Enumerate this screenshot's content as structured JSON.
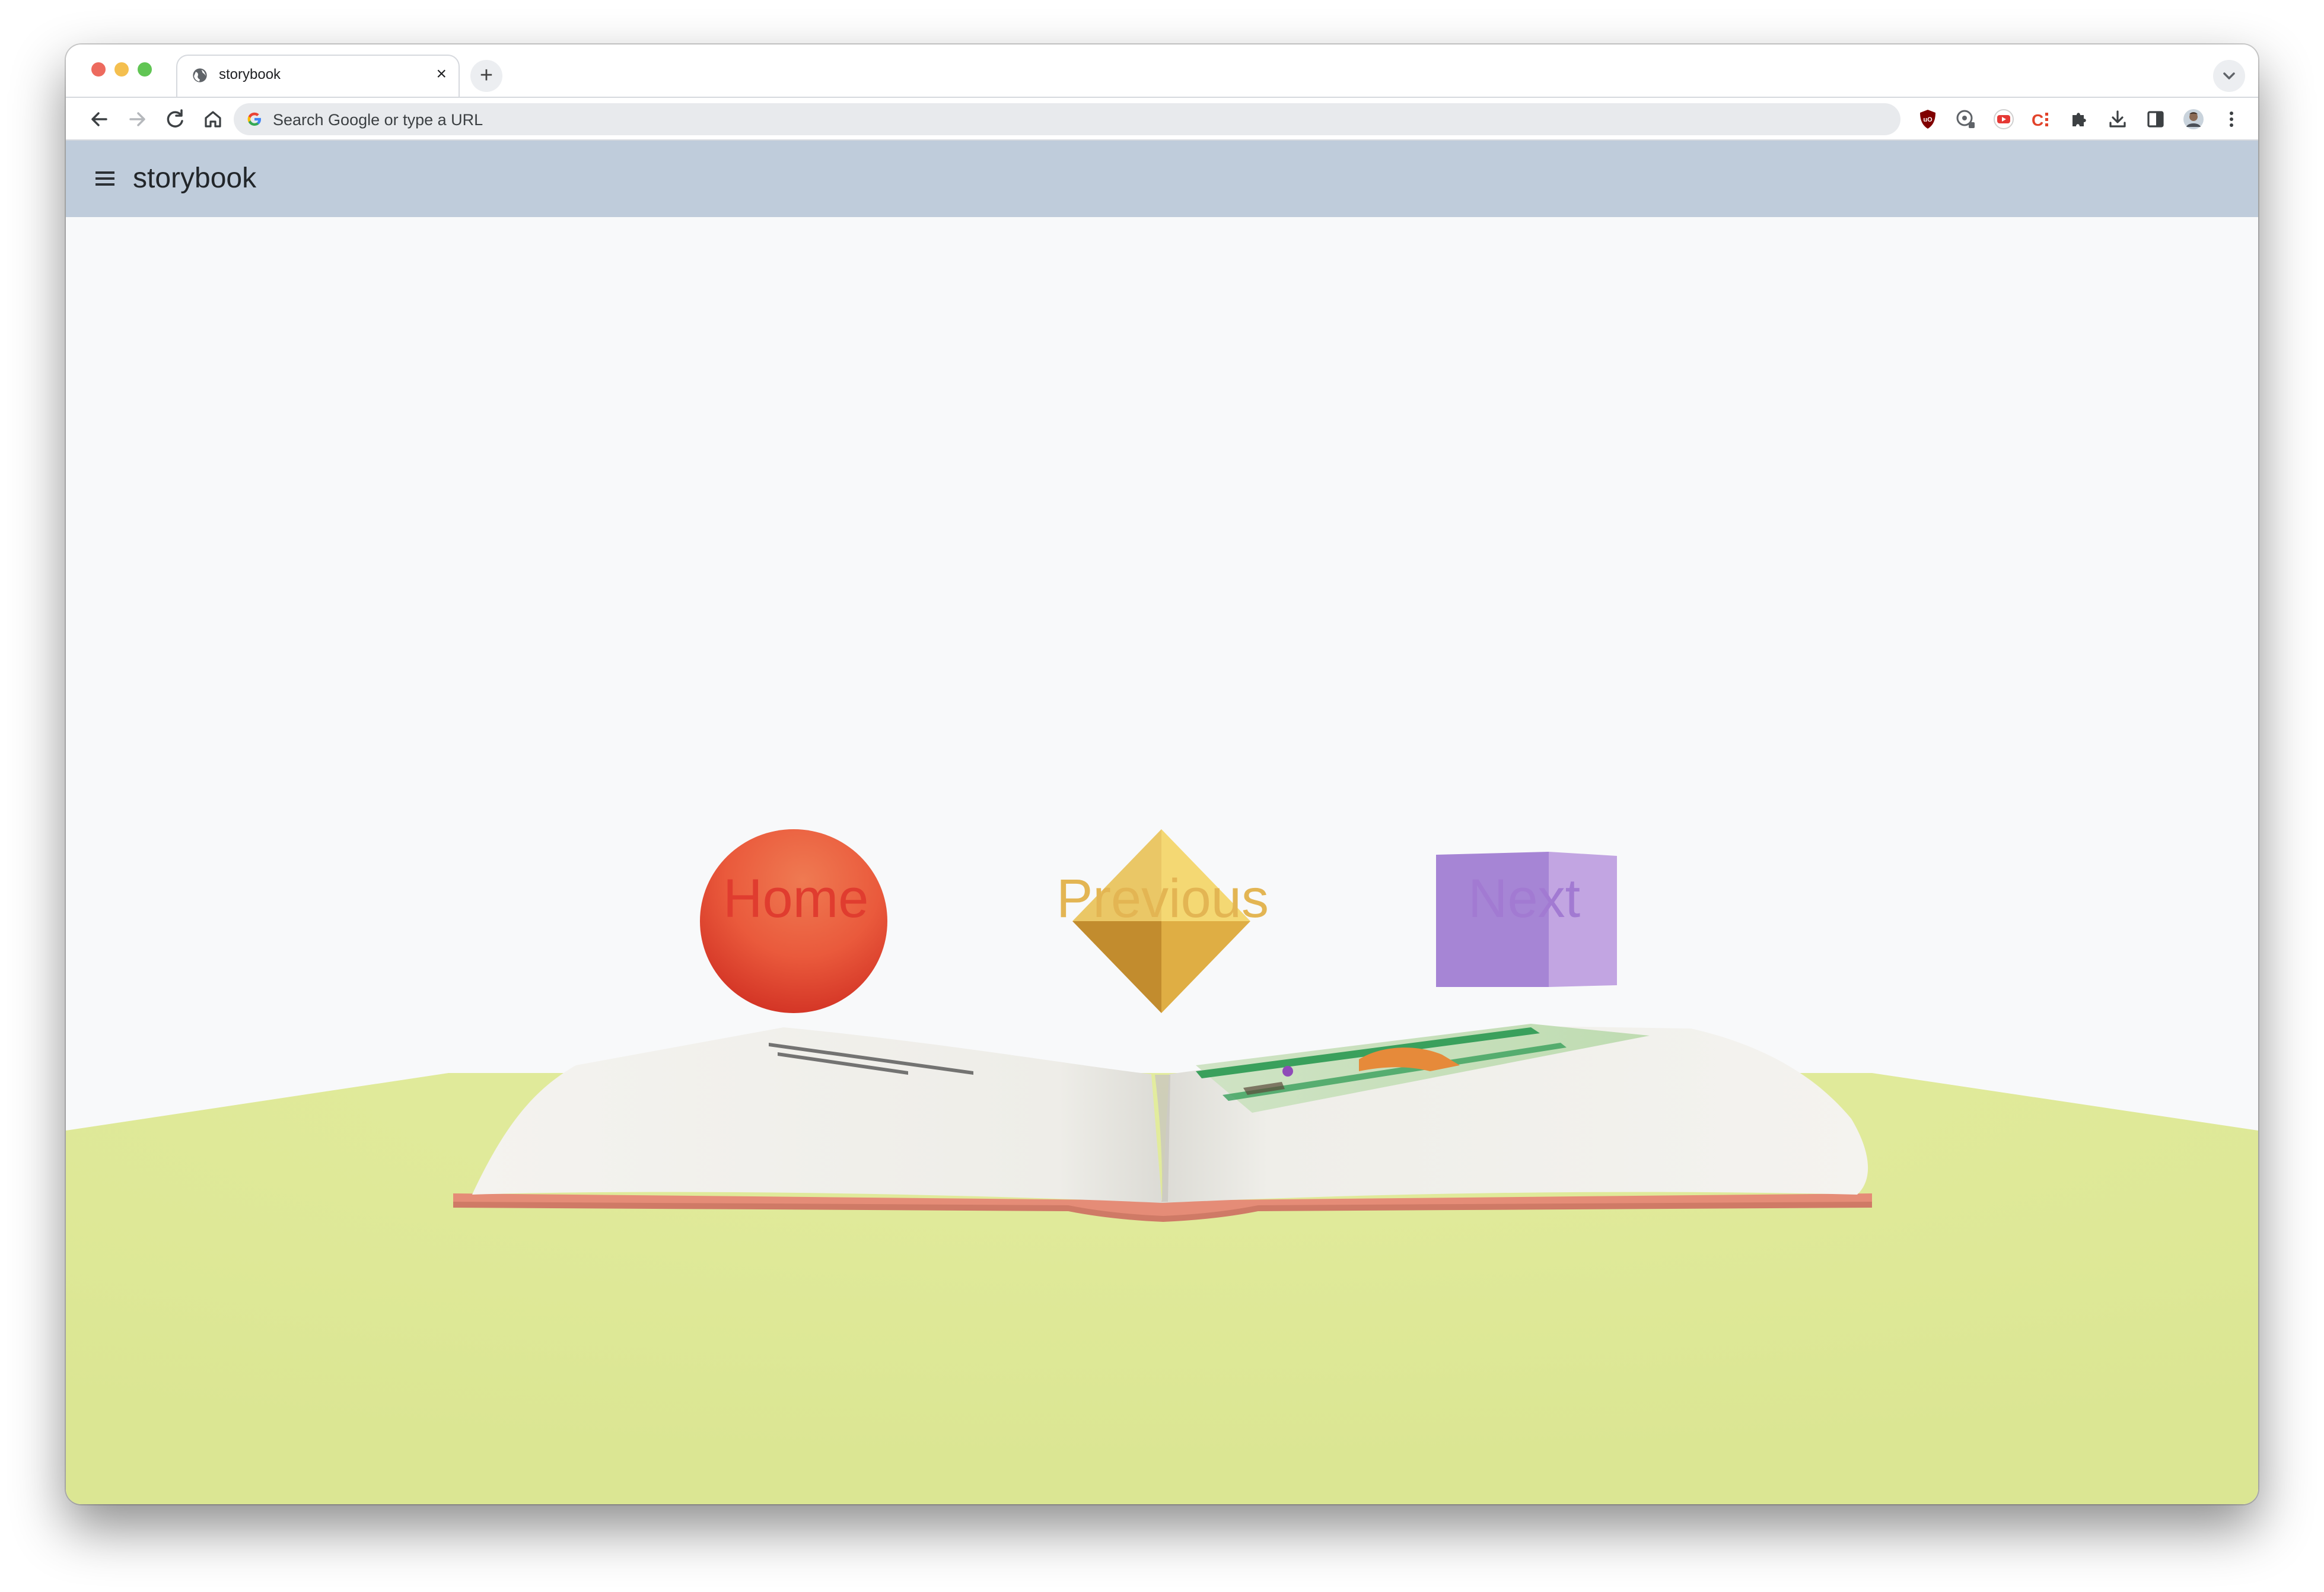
{
  "browser": {
    "tab_title": "storybook",
    "tab_close": "×",
    "new_tab": "+",
    "omnibox_placeholder": "Search Google or type a URL"
  },
  "app": {
    "title": "storybook"
  },
  "nav": {
    "home": {
      "label": "Home",
      "color": "#e03c2f",
      "shape": "sphere"
    },
    "previous": {
      "label": "Previous",
      "color": "#e3b553",
      "shape": "octahedron"
    },
    "next": {
      "label": "Next",
      "color": "#a27ad2",
      "shape": "cube"
    }
  },
  "colors": {
    "app_bar": "#bfccdb",
    "background": "#f8f9fa",
    "ground": "#dce796",
    "book_cover": "#e58c77",
    "book_page": "#f2f1ec"
  }
}
